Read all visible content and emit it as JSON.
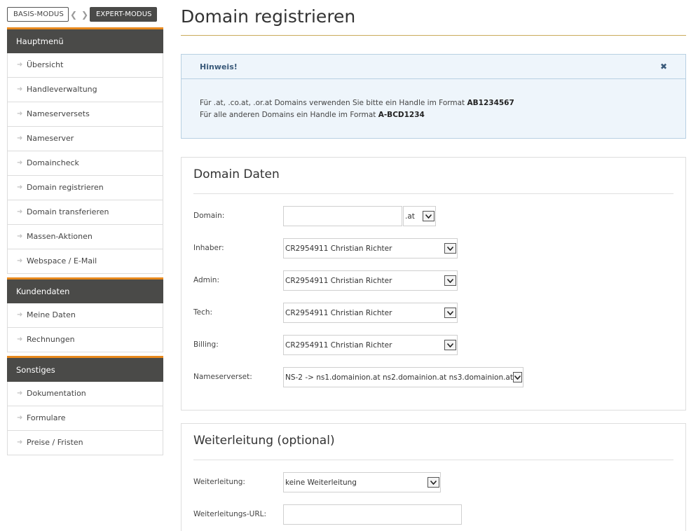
{
  "mode_switch": {
    "basic_label": "BASIS-MODUS",
    "expert_label": "EXPERT-MODUS"
  },
  "sidebar": {
    "groups": [
      {
        "header": "Hauptmenü",
        "items": [
          {
            "label": "Übersicht"
          },
          {
            "label": "Handleverwaltung"
          },
          {
            "label": "Nameserversets"
          },
          {
            "label": "Nameserver"
          },
          {
            "label": "Domaincheck"
          },
          {
            "label": "Domain registrieren"
          },
          {
            "label": "Domain transferieren"
          },
          {
            "label": "Massen-Aktionen"
          },
          {
            "label": "Webspace / E-Mail"
          }
        ]
      },
      {
        "header": "Kundendaten",
        "items": [
          {
            "label": "Meine Daten"
          },
          {
            "label": "Rechnungen"
          }
        ]
      },
      {
        "header": "Sonstiges",
        "items": [
          {
            "label": "Dokumentation"
          },
          {
            "label": "Formulare"
          },
          {
            "label": "Preise / Fristen"
          }
        ]
      }
    ]
  },
  "page": {
    "title": "Domain registrieren"
  },
  "notice": {
    "title": "Hinweis!",
    "close_icon": "close-icon",
    "line1_text": "Für .at, .co.at, .or.at Domains verwenden Sie bitte ein Handle im Format ",
    "line1_bold": "AB1234567",
    "line2_text": "Für alle anderen Domains ein Handle im Format ",
    "line2_bold": "A-BCD1234"
  },
  "domain_data": {
    "title": "Domain Daten",
    "domain": {
      "label": "Domain:",
      "value": "",
      "tld": ".at"
    },
    "inhaber": {
      "label": "Inhaber:",
      "value": "CR2954911 Christian Richter"
    },
    "admin": {
      "label": "Admin:",
      "value": "CR2954911 Christian Richter"
    },
    "tech": {
      "label": "Tech:",
      "value": "CR2954911 Christian Richter"
    },
    "billing": {
      "label": "Billing:",
      "value": "CR2954911 Christian Richter"
    },
    "nameserverset": {
      "label": "Nameserverset:",
      "value": "NS-2 -> ns1.domainion.at ns2.domainion.at ns3.domainion.at"
    }
  },
  "forwarding": {
    "title": "Weiterleitung (optional)",
    "weiterleitung": {
      "label": "Weiterleitung:",
      "value": "keine Weiterleitung"
    },
    "url": {
      "label": "Weiterleitungs-URL:",
      "value": ""
    }
  },
  "colors": {
    "accent": "#e8891d",
    "menu_header_bg": "#4a4a48",
    "notice_bg": "#eef5fb",
    "notice_border": "#b8d0e2",
    "title_rule": "#c9ab5a"
  }
}
